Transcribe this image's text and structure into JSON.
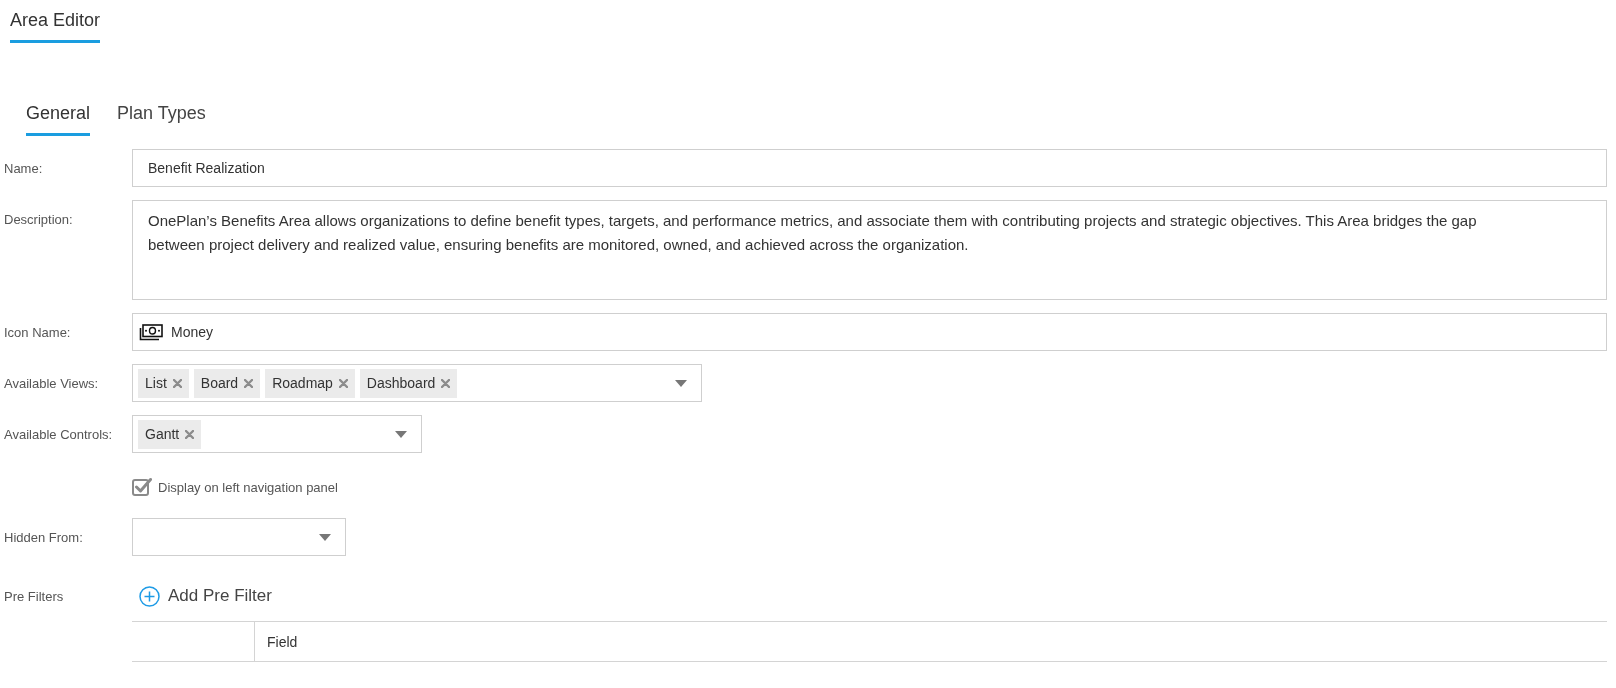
{
  "page_tabs": [
    {
      "label": "Area Editor",
      "selected": true
    }
  ],
  "tabs": [
    {
      "label": "General",
      "selected": true
    },
    {
      "label": "Plan Types",
      "selected": false
    }
  ],
  "fields": [
    {
      "kind": "text",
      "label": "Name:",
      "value": "Benefit Realization"
    },
    {
      "kind": "textarea",
      "label": "Description:",
      "value": "OnePlan’s Benefits Area allows organizations to define benefit types, targets, and performance metrics, and associate them with contributing projects and strategic objectives. This Area bridges the gap between project delivery and realized value, ensuring benefits are monitored, owned, and achieved across the organization."
    },
    {
      "kind": "icon",
      "label": "Icon Name:",
      "value": "Money"
    },
    {
      "kind": "multiselect",
      "label": "Available Views:",
      "tags": [
        "List",
        "Board",
        "Roadmap",
        "Dashboard"
      ]
    },
    {
      "kind": "multiselect",
      "label": "Available Controls:",
      "tags": [
        "Gantt"
      ]
    },
    {
      "kind": "checkbox",
      "label": "Display on left navigation panel",
      "checked": true
    },
    {
      "kind": "select",
      "label": "Hidden From:"
    }
  ],
  "pre_filters": {
    "label": "Pre Filters",
    "add_button": "Add Pre Filter",
    "table": {
      "columns": [
        "Field"
      ]
    }
  }
}
